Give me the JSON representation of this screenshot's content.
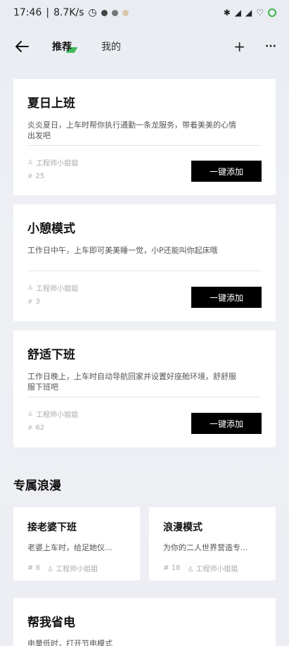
{
  "status_bar": {
    "time": "17:46",
    "net_speed": "8.7K/s",
    "right_icons": [
      "bluetooth-icon",
      "signal-icon",
      "signal-icon",
      "wifi-icon",
      "battery-icon"
    ]
  },
  "nav": {
    "tabs": [
      {
        "label": "推荐",
        "active": true
      },
      {
        "label": "我的",
        "active": false
      }
    ],
    "add_label": "+",
    "more_label": "···"
  },
  "cards": [
    {
      "title": "夏日上班",
      "desc_lines": [
        "炎炎夏日，上车时帮你执行通勤一条龙服务，带着美美的心情",
        "出发吧"
      ],
      "author": "工程师小姐姐",
      "count": "25",
      "button": "一键添加"
    },
    {
      "title": "小憩模式",
      "desc_lines": [
        "工作日中午，上车即可美美睡一觉，小P还能叫你起床哦"
      ],
      "author": "工程师小姐姐",
      "count": "3",
      "button": "一键添加"
    },
    {
      "title": "舒适下班",
      "desc_lines": [
        "工作日晚上，上车时自动导航回家并设置好座舱环境，舒舒服",
        "服下班吧"
      ],
      "author": "工程师小姐姐",
      "count": "62",
      "button": "一键添加"
    }
  ],
  "section": {
    "title": "专属浪漫"
  },
  "small_cards": [
    {
      "title": "接老婆下班",
      "desc": "老婆上车时，给足她仪...",
      "count": "8",
      "author": "工程师小姐姐"
    },
    {
      "title": "浪漫模式",
      "desc": "为你的二人世界营造专...",
      "count": "18",
      "author": "工程师小姐姐"
    }
  ],
  "bottom_card": {
    "title": "帮我省电",
    "desc": "电量低时，打开节电模式"
  },
  "colors": {
    "accent": "#2fb34a",
    "button_bg": "#000000"
  }
}
